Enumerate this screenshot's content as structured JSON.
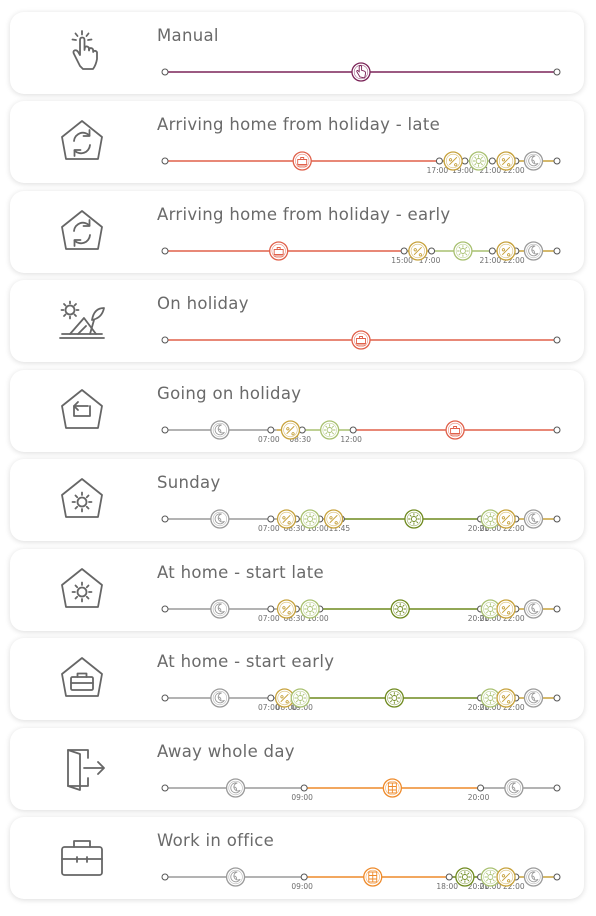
{
  "colors": {
    "manual": "#7b2458",
    "holiday": "#e0604a",
    "night": "#9a9a9a",
    "morning": "#c7a23c",
    "day": "#6f8a1f",
    "lightday": "#a8c070",
    "away": "#ee8a2a"
  },
  "schedules": [
    {
      "title": "Manual",
      "icon": "hand-touch-icon",
      "segments": [
        {
          "from": 0,
          "to": 1,
          "color": "manual"
        }
      ],
      "markers": [
        {
          "pos": 0.5,
          "color": "manual",
          "symbol": "hand"
        }
      ],
      "times": []
    },
    {
      "title": "Arriving home from holiday - late",
      "icon": "house-cycle-icon",
      "segments": [
        {
          "from": 0,
          "to": 0.7,
          "color": "holiday"
        },
        {
          "from": 0.7,
          "to": 0.765,
          "color": "morning"
        },
        {
          "from": 0.765,
          "to": 0.835,
          "color": "lightday"
        },
        {
          "from": 0.835,
          "to": 1,
          "color": "morning"
        }
      ],
      "markers": [
        {
          "pos": 0.35,
          "color": "holiday",
          "symbol": "suitcase"
        },
        {
          "pos": 0.735,
          "color": "morning",
          "symbol": "percent"
        },
        {
          "pos": 0.8,
          "color": "lightday",
          "symbol": "sun"
        },
        {
          "pos": 0.87,
          "color": "morning",
          "symbol": "percent"
        },
        {
          "pos": 0.94,
          "color": "night",
          "symbol": "moon"
        }
      ],
      "times": [
        {
          "pos": 0.7,
          "text": "17:00"
        },
        {
          "pos": 0.765,
          "text": "19:00"
        },
        {
          "pos": 0.835,
          "text": "21:00"
        },
        {
          "pos": 0.895,
          "text": "22:00"
        }
      ]
    },
    {
      "title": "Arriving home from holiday - early",
      "icon": "house-cycle-icon",
      "segments": [
        {
          "from": 0,
          "to": 0.61,
          "color": "holiday"
        },
        {
          "from": 0.61,
          "to": 0.68,
          "color": "morning"
        },
        {
          "from": 0.68,
          "to": 0.835,
          "color": "lightday"
        },
        {
          "from": 0.835,
          "to": 1,
          "color": "morning"
        }
      ],
      "markers": [
        {
          "pos": 0.29,
          "color": "holiday",
          "symbol": "suitcase"
        },
        {
          "pos": 0.645,
          "color": "morning",
          "symbol": "percent"
        },
        {
          "pos": 0.76,
          "color": "lightday",
          "symbol": "sun"
        },
        {
          "pos": 0.87,
          "color": "morning",
          "symbol": "percent"
        },
        {
          "pos": 0.94,
          "color": "night",
          "symbol": "moon"
        }
      ],
      "times": [
        {
          "pos": 0.61,
          "text": "15:00"
        },
        {
          "pos": 0.68,
          "text": "17:00"
        },
        {
          "pos": 0.835,
          "text": "21:00"
        },
        {
          "pos": 0.895,
          "text": "22:00"
        }
      ]
    },
    {
      "title": "On holiday",
      "icon": "deckchair-icon",
      "segments": [
        {
          "from": 0,
          "to": 1,
          "color": "holiday"
        }
      ],
      "markers": [
        {
          "pos": 0.5,
          "color": "holiday",
          "symbol": "suitcase"
        }
      ],
      "times": []
    },
    {
      "title": "Going on holiday",
      "icon": "house-exit-icon",
      "segments": [
        {
          "from": 0,
          "to": 0.285,
          "color": "night"
        },
        {
          "from": 0.285,
          "to": 0.35,
          "color": "morning"
        },
        {
          "from": 0.35,
          "to": 0.48,
          "color": "lightday"
        },
        {
          "from": 0.48,
          "to": 1,
          "color": "holiday"
        }
      ],
      "markers": [
        {
          "pos": 0.14,
          "color": "night",
          "symbol": "moon"
        },
        {
          "pos": 0.32,
          "color": "morning",
          "symbol": "percent"
        },
        {
          "pos": 0.42,
          "color": "lightday",
          "symbol": "sun"
        },
        {
          "pos": 0.74,
          "color": "holiday",
          "symbol": "suitcase"
        }
      ],
      "times": [
        {
          "pos": 0.27,
          "text": "07:00"
        },
        {
          "pos": 0.35,
          "text": "08:30"
        },
        {
          "pos": 0.48,
          "text": "12:00"
        }
      ]
    },
    {
      "title": "Sunday",
      "icon": "house-sun-icon",
      "segments": [
        {
          "from": 0,
          "to": 0.285,
          "color": "night"
        },
        {
          "from": 0.285,
          "to": 0.45,
          "color": "morning"
        },
        {
          "from": 0.45,
          "to": 0.805,
          "color": "day"
        },
        {
          "from": 0.805,
          "to": 0.86,
          "color": "lightday"
        },
        {
          "from": 0.86,
          "to": 1,
          "color": "morning"
        }
      ],
      "markers": [
        {
          "pos": 0.14,
          "color": "night",
          "symbol": "moon"
        },
        {
          "pos": 0.31,
          "color": "morning",
          "symbol": "percent"
        },
        {
          "pos": 0.37,
          "color": "lightday",
          "symbol": "sun"
        },
        {
          "pos": 0.43,
          "color": "morning",
          "symbol": "percent"
        },
        {
          "pos": 0.635,
          "color": "day",
          "symbol": "sun"
        },
        {
          "pos": 0.83,
          "color": "lightday",
          "symbol": "sun"
        },
        {
          "pos": 0.87,
          "color": "morning",
          "symbol": "percent"
        },
        {
          "pos": 0.94,
          "color": "night",
          "symbol": "moon"
        }
      ],
      "times": [
        {
          "pos": 0.27,
          "text": "07:00"
        },
        {
          "pos": 0.335,
          "text": "08:30"
        },
        {
          "pos": 0.395,
          "text": "10:00"
        },
        {
          "pos": 0.45,
          "text": "11:45"
        },
        {
          "pos": 0.805,
          "text": "20:00"
        },
        {
          "pos": 0.835,
          "text": "21:00"
        },
        {
          "pos": 0.895,
          "text": "22:00"
        }
      ]
    },
    {
      "title": "At home - start late",
      "icon": "house-sun-icon",
      "segments": [
        {
          "from": 0,
          "to": 0.285,
          "color": "night"
        },
        {
          "from": 0.285,
          "to": 0.395,
          "color": "morning"
        },
        {
          "from": 0.395,
          "to": 0.805,
          "color": "day"
        },
        {
          "from": 0.805,
          "to": 0.86,
          "color": "lightday"
        },
        {
          "from": 0.86,
          "to": 1,
          "color": "morning"
        }
      ],
      "markers": [
        {
          "pos": 0.14,
          "color": "night",
          "symbol": "moon"
        },
        {
          "pos": 0.31,
          "color": "morning",
          "symbol": "percent"
        },
        {
          "pos": 0.37,
          "color": "lightday",
          "symbol": "sun"
        },
        {
          "pos": 0.6,
          "color": "day",
          "symbol": "sun"
        },
        {
          "pos": 0.83,
          "color": "lightday",
          "symbol": "sun"
        },
        {
          "pos": 0.87,
          "color": "morning",
          "symbol": "percent"
        },
        {
          "pos": 0.94,
          "color": "night",
          "symbol": "moon"
        }
      ],
      "times": [
        {
          "pos": 0.27,
          "text": "07:00"
        },
        {
          "pos": 0.335,
          "text": "08:30"
        },
        {
          "pos": 0.395,
          "text": "10:00"
        },
        {
          "pos": 0.805,
          "text": "20:00"
        },
        {
          "pos": 0.835,
          "text": "21:00"
        },
        {
          "pos": 0.895,
          "text": "22:00"
        }
      ]
    },
    {
      "title": "At home - start early",
      "icon": "house-briefcase-icon",
      "segments": [
        {
          "from": 0,
          "to": 0.285,
          "color": "night"
        },
        {
          "from": 0.285,
          "to": 0.355,
          "color": "morning"
        },
        {
          "from": 0.355,
          "to": 0.805,
          "color": "day"
        },
        {
          "from": 0.805,
          "to": 0.86,
          "color": "lightday"
        },
        {
          "from": 0.86,
          "to": 1,
          "color": "morning"
        }
      ],
      "markers": [
        {
          "pos": 0.14,
          "color": "night",
          "symbol": "moon"
        },
        {
          "pos": 0.305,
          "color": "morning",
          "symbol": "percent"
        },
        {
          "pos": 0.345,
          "color": "lightday",
          "symbol": "sun"
        },
        {
          "pos": 0.585,
          "color": "day",
          "symbol": "sun"
        },
        {
          "pos": 0.83,
          "color": "lightday",
          "symbol": "sun"
        },
        {
          "pos": 0.87,
          "color": "morning",
          "symbol": "percent"
        },
        {
          "pos": 0.94,
          "color": "night",
          "symbol": "moon"
        }
      ],
      "times": [
        {
          "pos": 0.27,
          "text": "07:00"
        },
        {
          "pos": 0.315,
          "text": "08:00"
        },
        {
          "pos": 0.355,
          "text": "09:00"
        },
        {
          "pos": 0.805,
          "text": "20:00"
        },
        {
          "pos": 0.835,
          "text": "21:00"
        },
        {
          "pos": 0.895,
          "text": "22:00"
        }
      ]
    },
    {
      "title": "Away whole day",
      "icon": "door-exit-icon",
      "segments": [
        {
          "from": 0,
          "to": 0.355,
          "color": "night"
        },
        {
          "from": 0.355,
          "to": 0.805,
          "color": "away"
        },
        {
          "from": 0.805,
          "to": 1,
          "color": "night"
        }
      ],
      "markers": [
        {
          "pos": 0.18,
          "color": "night",
          "symbol": "moon"
        },
        {
          "pos": 0.58,
          "color": "away",
          "symbol": "building"
        },
        {
          "pos": 0.89,
          "color": "night",
          "symbol": "moon"
        }
      ],
      "times": [
        {
          "pos": 0.355,
          "text": "09:00"
        },
        {
          "pos": 0.805,
          "text": "20:00"
        }
      ]
    },
    {
      "title": "Work in office",
      "icon": "briefcase-icon",
      "segments": [
        {
          "from": 0,
          "to": 0.355,
          "color": "night"
        },
        {
          "from": 0.355,
          "to": 0.725,
          "color": "away"
        },
        {
          "from": 0.725,
          "to": 0.805,
          "color": "day"
        },
        {
          "from": 0.805,
          "to": 0.86,
          "color": "lightday"
        },
        {
          "from": 0.86,
          "to": 1,
          "color": "morning"
        }
      ],
      "markers": [
        {
          "pos": 0.18,
          "color": "night",
          "symbol": "moon"
        },
        {
          "pos": 0.53,
          "color": "away",
          "symbol": "building"
        },
        {
          "pos": 0.765,
          "color": "day",
          "symbol": "sun"
        },
        {
          "pos": 0.83,
          "color": "lightday",
          "symbol": "sun"
        },
        {
          "pos": 0.87,
          "color": "morning",
          "symbol": "percent"
        },
        {
          "pos": 0.94,
          "color": "night",
          "symbol": "moon"
        }
      ],
      "times": [
        {
          "pos": 0.355,
          "text": "09:00"
        },
        {
          "pos": 0.725,
          "text": "18:00"
        },
        {
          "pos": 0.805,
          "text": "20:00"
        },
        {
          "pos": 0.835,
          "text": "21:00"
        },
        {
          "pos": 0.895,
          "text": "22:00"
        }
      ]
    }
  ]
}
